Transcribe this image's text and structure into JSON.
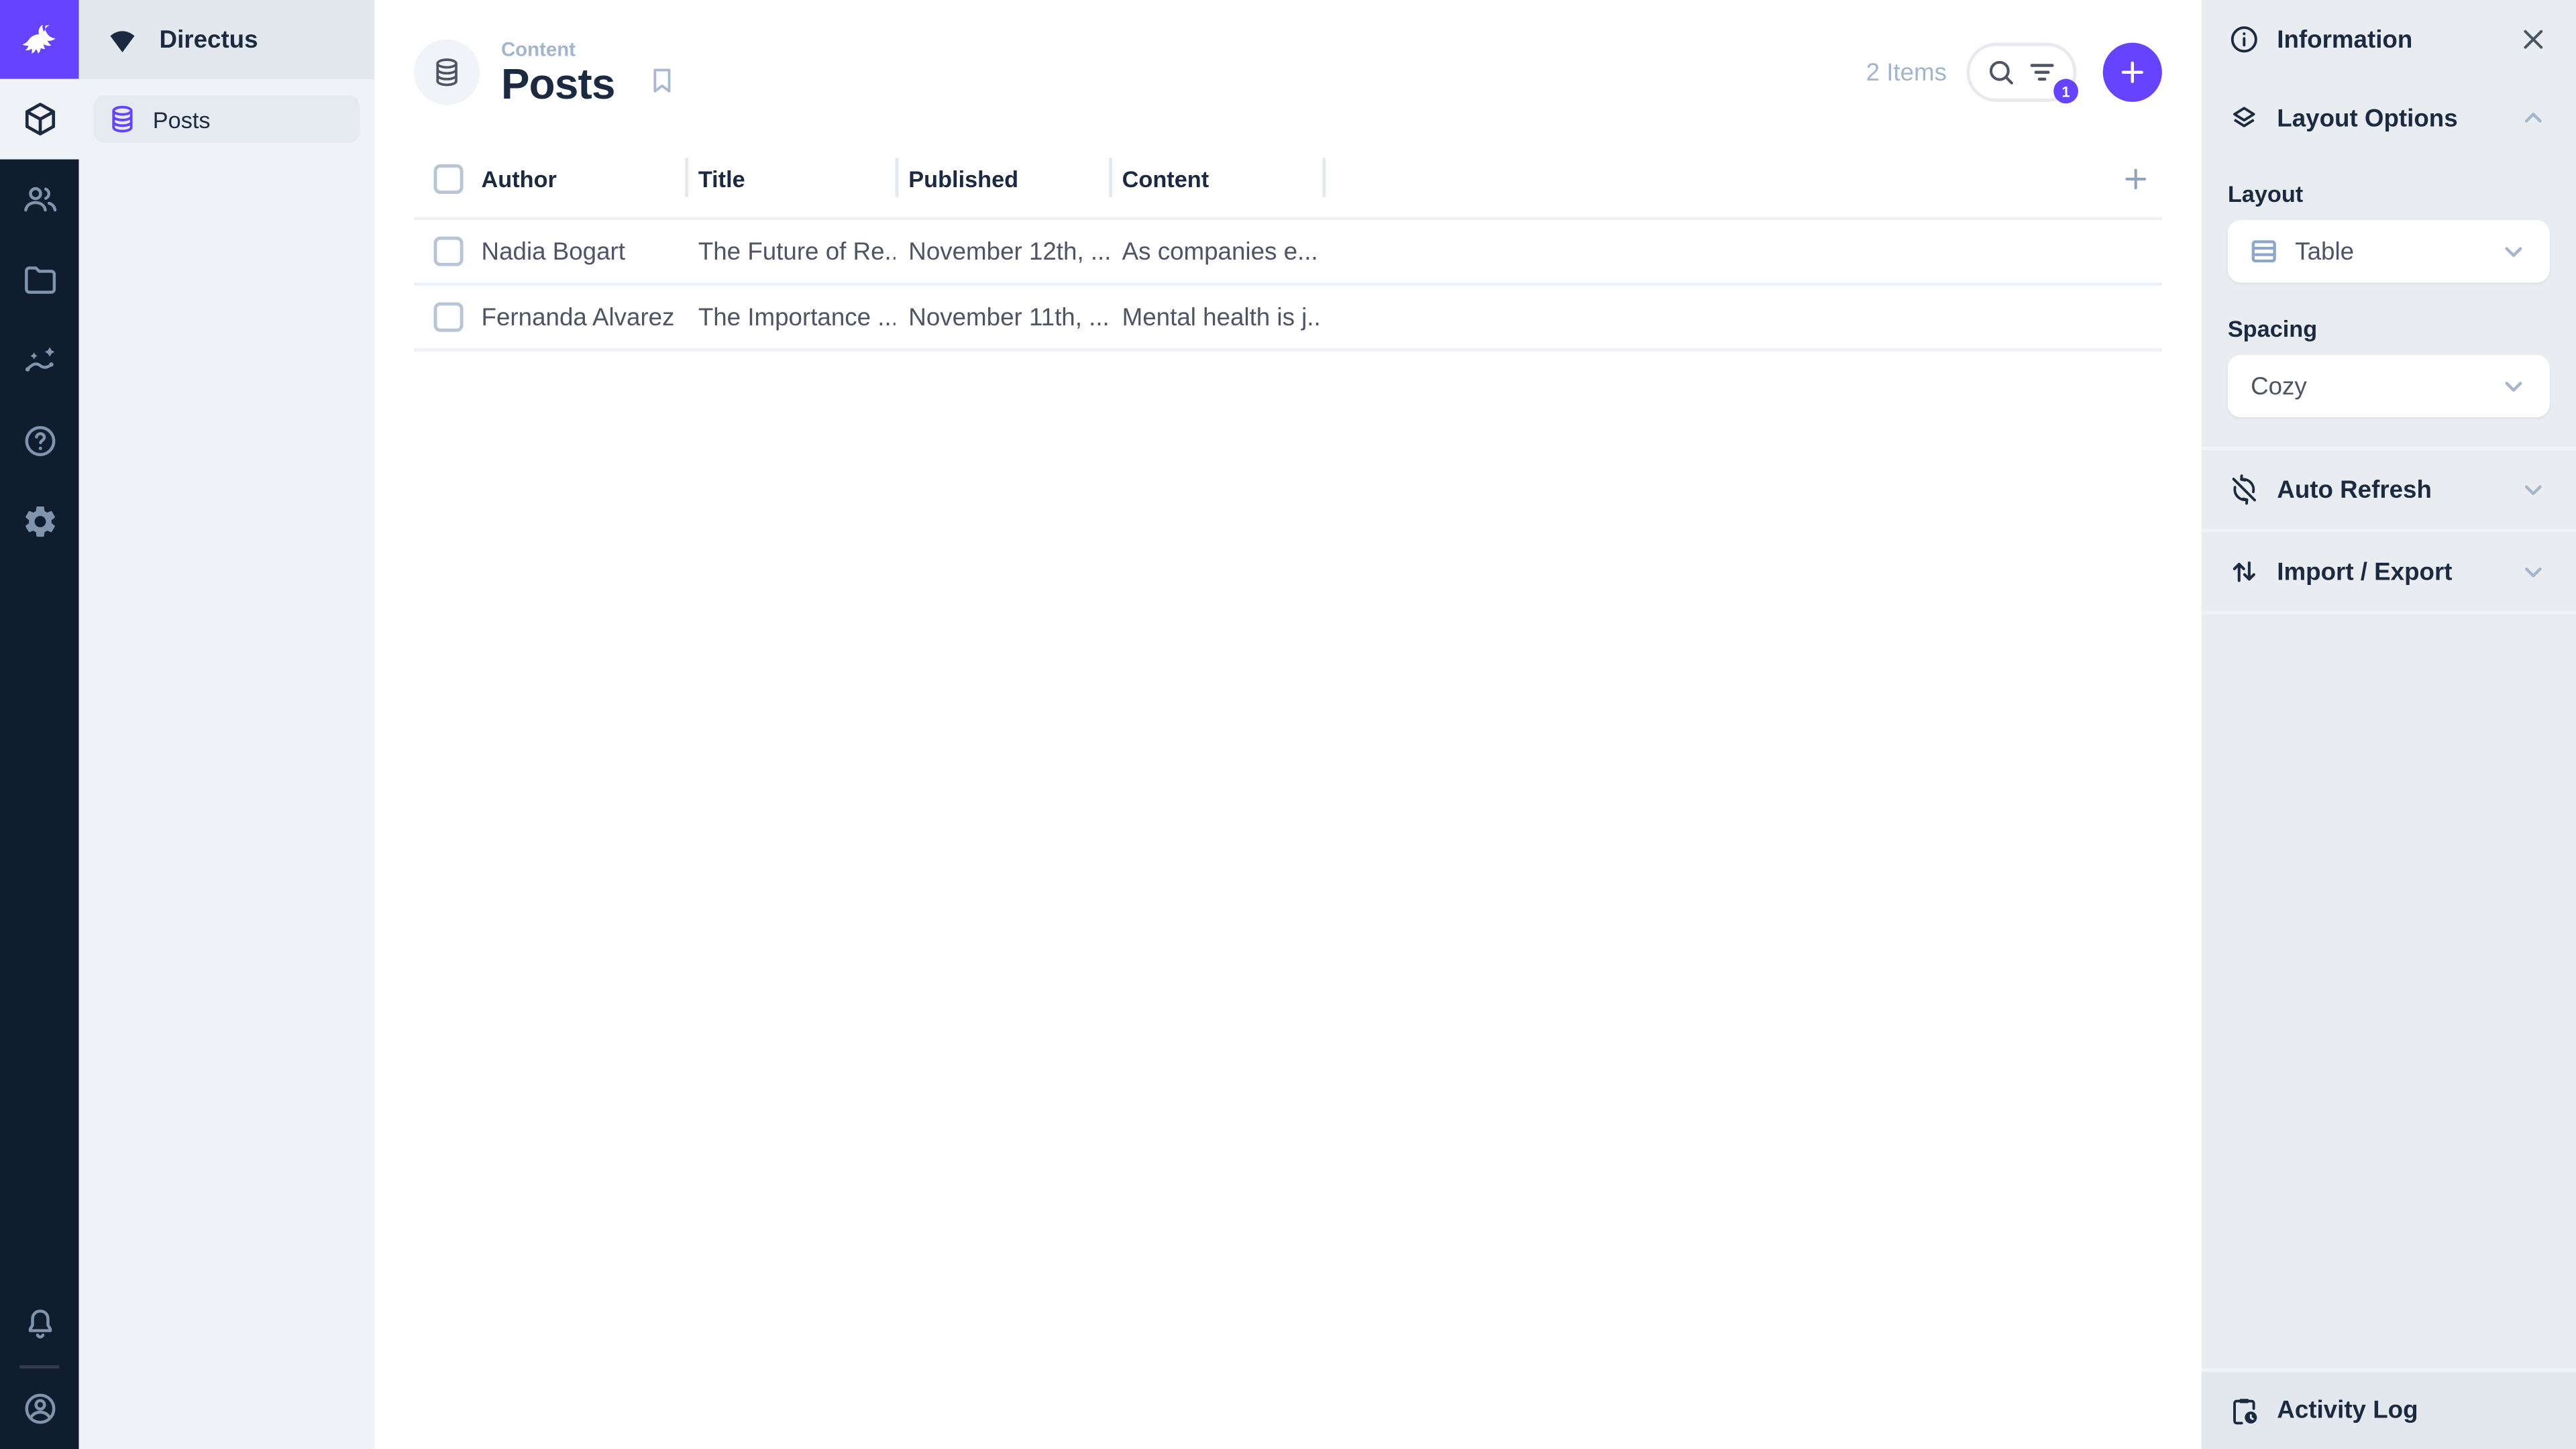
{
  "colors": {
    "accent": "#6644FF",
    "module_bar_bg": "#101D2F"
  },
  "nav": {
    "project_name": "Directus",
    "items": [
      {
        "label": "Posts",
        "icon": "database-icon",
        "active": true
      }
    ]
  },
  "module_bar": {
    "items": [
      "content-module",
      "users-module",
      "files-module",
      "insights-module",
      "help-module",
      "settings-module"
    ],
    "bottom_items": [
      "notifications",
      "account"
    ]
  },
  "header": {
    "breadcrumb": "Content",
    "title": "Posts",
    "items_count": "2 Items",
    "filter_badge": "1"
  },
  "table": {
    "columns": [
      "Author",
      "Title",
      "Published",
      "Content"
    ],
    "rows": [
      {
        "selected": false,
        "author": "Nadia Bogart",
        "title": "The Future of Re...",
        "published": "November 12th, ...",
        "content": "As companies e..."
      },
      {
        "selected": false,
        "author": "Fernanda Alvarez",
        "title": "The Importance ...",
        "published": "November 11th, ...",
        "content": "Mental health is j..."
      }
    ]
  },
  "sidebar": {
    "title": "Information",
    "layout_section": {
      "title": "Layout Options",
      "layout_label": "Layout",
      "layout_value": "Table",
      "spacing_label": "Spacing",
      "spacing_value": "Cozy"
    },
    "sections": [
      {
        "label": "Auto Refresh",
        "icon": "sync-disabled-icon"
      },
      {
        "label": "Import / Export",
        "icon": "swap-vert-icon"
      }
    ],
    "activity_log_label": "Activity Log"
  }
}
